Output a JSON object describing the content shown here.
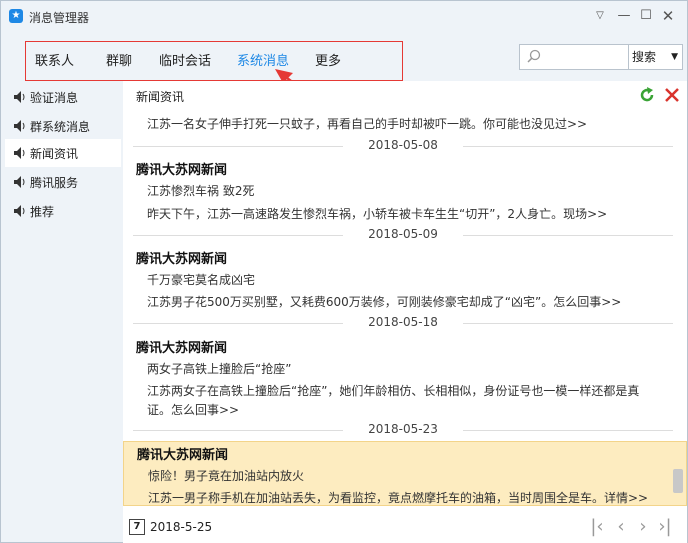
{
  "window": {
    "title": "消息管理器"
  },
  "tabs": [
    {
      "label": "联系人"
    },
    {
      "label": "群聊"
    },
    {
      "label": "临时会话"
    },
    {
      "label": "系统消息"
    },
    {
      "label": "更多"
    }
  ],
  "search": {
    "placeholder": "",
    "button_label": "搜索"
  },
  "sidebar": {
    "items": [
      {
        "label": "验证消息"
      },
      {
        "label": "群系统消息"
      },
      {
        "label": "新闻资讯"
      },
      {
        "label": "腾讯服务"
      },
      {
        "label": "推荐"
      }
    ]
  },
  "content": {
    "section_title": "新闻资讯",
    "first_line": "江苏一名女子伸手打死一只蚊子，再看自己的手时却被吓一跳。你可能也没见过>>",
    "groups": [
      {
        "date": "2018-05-08",
        "sender": "腾讯大苏网新闻",
        "headline": "江苏惨烈车祸 致2死",
        "summary": "昨天下午，江苏一高速路发生惨烈车祸，小轿车被卡车生生“切开”，2人身亡。现场>>"
      },
      {
        "date": "2018-05-09",
        "sender": "腾讯大苏网新闻",
        "headline": "千万豪宅莫名成凶宅",
        "summary": "江苏男子花500万买别墅，又耗费600万装修，可刚装修豪宅却成了“凶宅”。怎么回事>>"
      },
      {
        "date": "2018-05-18",
        "sender": "腾讯大苏网新闻",
        "headline": "两女子高铁上撞脸后“抢座”",
        "summary": "江苏两女子在高铁上撞脸后“抢座”，她们年龄相仿、长相相似，身份证号也一模一样还都是真",
        "summary2": "证。怎么回事>>"
      },
      {
        "date": "2018-05-23",
        "sender": "腾讯大苏网新闻",
        "headline": "惊险！男子竟在加油站内放火",
        "summary": "江苏一男子称手机在加油站丢失，为看监控，竟点燃摩托车的油箱，当时周围全是车。详情>>"
      }
    ]
  },
  "footer": {
    "calendar_day": "7",
    "date": "2018-5-25"
  },
  "colors": {
    "accent": "#1e88e5",
    "highlight_bg": "#fdecc0",
    "annotation": "#e53935"
  }
}
